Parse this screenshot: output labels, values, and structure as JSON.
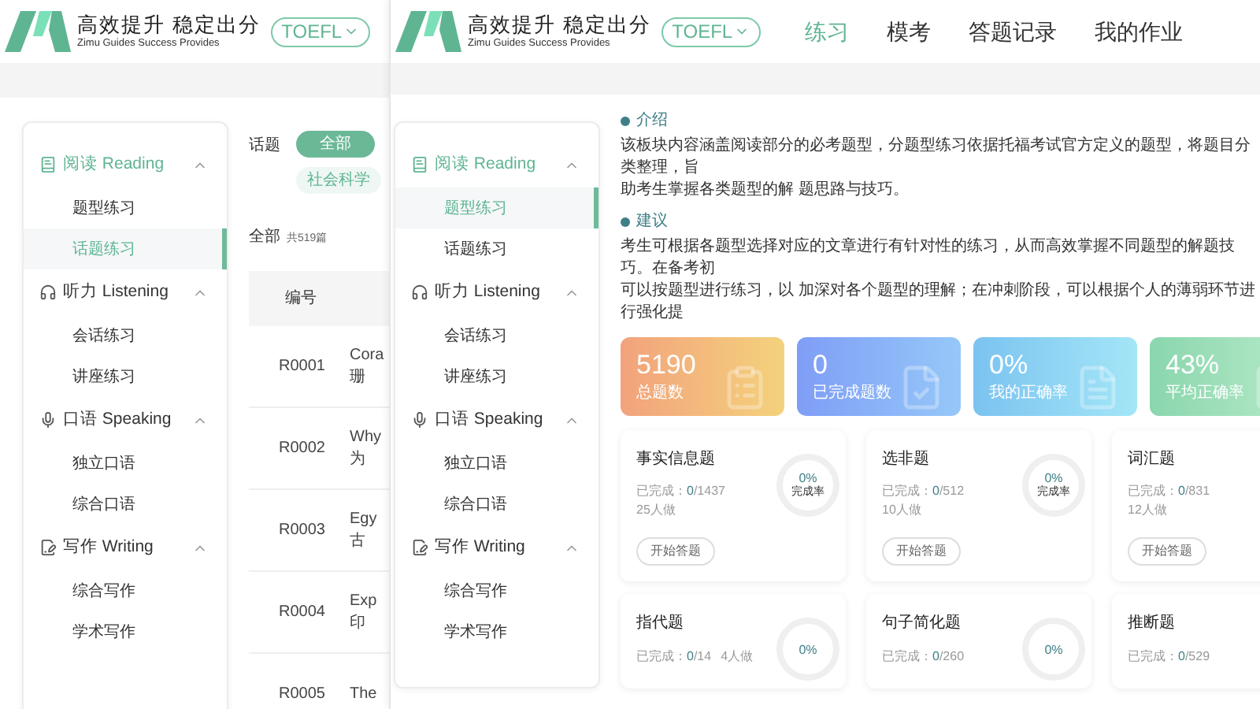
{
  "background_window": {
    "brand": {
      "title": "高效提升 稳定出分",
      "subtitle": "Zimu Guides Success Provides"
    },
    "exam_selector": "TOEFL",
    "sidebar": [
      {
        "kind": "reading",
        "label": "阅读 Reading",
        "expanded": true,
        "items": [
          {
            "label": "题型练习",
            "selected": false
          },
          {
            "label": "话题练习",
            "selected": true
          }
        ]
      },
      {
        "kind": "listening",
        "label": "听力 Listening",
        "expanded": true,
        "items": [
          {
            "label": "会话练习",
            "selected": false
          },
          {
            "label": "讲座练习",
            "selected": false
          }
        ]
      },
      {
        "kind": "speaking",
        "label": "口语 Speaking",
        "expanded": true,
        "items": [
          {
            "label": "独立口语",
            "selected": false
          },
          {
            "label": "综合口语",
            "selected": false
          }
        ]
      },
      {
        "kind": "writing",
        "label": "写作 Writing",
        "expanded": true,
        "items": [
          {
            "label": "综合写作",
            "selected": false
          },
          {
            "label": "学术写作",
            "selected": false
          }
        ]
      }
    ],
    "topic_filter": {
      "label": "话题",
      "chips": [
        {
          "label": "全部",
          "selected": true
        },
        {
          "label": "社会科学",
          "selected": false
        }
      ]
    },
    "summary": {
      "label": "全部",
      "count": "共519篇"
    },
    "table": {
      "columns": [
        "编号"
      ],
      "rows": [
        {
          "code": "R0001",
          "column_2": [
            "Cora",
            "珊"
          ]
        },
        {
          "code": "R0002",
          "column_2": [
            "Why",
            "为"
          ]
        },
        {
          "code": "R0003",
          "column_2": [
            "Egy",
            "古"
          ]
        },
        {
          "code": "R0004",
          "column_2": [
            "Exp",
            "印"
          ]
        },
        {
          "code": "R0005",
          "column_2": [
            "The"
          ]
        }
      ]
    }
  },
  "window": {
    "brand": {
      "title": "高效提升 稳定出分",
      "subtitle": "Zimu Guides Success Provides"
    },
    "exam_selector": "TOEFL",
    "nav": [
      {
        "label": "练习",
        "selected": true
      },
      {
        "label": "模考",
        "selected": false
      },
      {
        "label": "答题记录",
        "selected": false
      },
      {
        "label": "我的作业",
        "selected": false
      }
    ],
    "sidebar": [
      {
        "kind": "reading",
        "label": "阅读 Reading",
        "expanded": true,
        "items": [
          {
            "label": "题型练习",
            "selected": true
          },
          {
            "label": "话题练习",
            "selected": false
          }
        ]
      },
      {
        "kind": "listening",
        "label": "听力 Listening",
        "expanded": true,
        "items": [
          {
            "label": "会话练习",
            "selected": false
          },
          {
            "label": "讲座练习",
            "selected": false
          }
        ]
      },
      {
        "kind": "speaking",
        "label": "口语 Speaking",
        "expanded": true,
        "items": [
          {
            "label": "独立口语",
            "selected": false
          },
          {
            "label": "综合口语",
            "selected": false
          }
        ]
      },
      {
        "kind": "writing",
        "label": "写作 Writing",
        "expanded": true,
        "items": [
          {
            "label": "综合写作",
            "selected": false
          },
          {
            "label": "学术写作",
            "selected": false
          }
        ]
      }
    ],
    "sections": [
      {
        "title": "介绍",
        "lines": [
          "该板块内容涵盖阅读部分的必考题型，分题型练习依据托福考试官方定义的题型，将题目分类整理，旨",
          "助考生掌握各类题型的解 题思路与技巧。"
        ]
      },
      {
        "title": "建议",
        "lines": [
          "考生可根据各题型选择对应的文章进行有针对性的练习，从而高效掌握不同题型的解题技巧。在备考初",
          "可以按题型进行练习，以 加深对各个题型的理解；在冲刺阶段，可以根据个人的薄弱环节进行强化提"
        ]
      }
    ],
    "stats": [
      {
        "kind": "total",
        "value": "5190",
        "label": "总题数"
      },
      {
        "kind": "done",
        "value": "0",
        "label": "已完成题数"
      },
      {
        "kind": "mine",
        "value": "0%",
        "label": "我的正确率"
      },
      {
        "kind": "average",
        "value": "43%",
        "label": "平均正确率"
      }
    ],
    "cards": [
      {
        "kind": "stacked",
        "title": "事实信息题",
        "completed_label": "已完成：",
        "done": "0",
        "total": "/1437",
        "people": "25人做",
        "rate": "0%",
        "rate_label": "完成率",
        "button": "开始答题"
      },
      {
        "kind": "stacked",
        "title": "选非题",
        "completed_label": "已完成：",
        "done": "0",
        "total": "/512",
        "people": "10人做",
        "rate": "0%",
        "rate_label": "完成率",
        "button": "开始答题"
      },
      {
        "kind": "stacked",
        "title": "词汇题",
        "completed_label": "已完成：",
        "done": "0",
        "total": "/831",
        "people": "12人做",
        "button": "开始答题"
      },
      {
        "kind": "inline",
        "title": "指代题",
        "completed_label": "已完成：",
        "done": "0",
        "total": "/14",
        "people": "4人做",
        "rate": "0%"
      },
      {
        "kind": "inline",
        "title": "句子简化题",
        "completed_label": "已完成：",
        "done": "0",
        "total": "/260",
        "rate": "0%"
      },
      {
        "kind": "inline",
        "title": "推断题",
        "completed_label": "已完成：",
        "done": "0",
        "total": "/529"
      }
    ]
  }
}
